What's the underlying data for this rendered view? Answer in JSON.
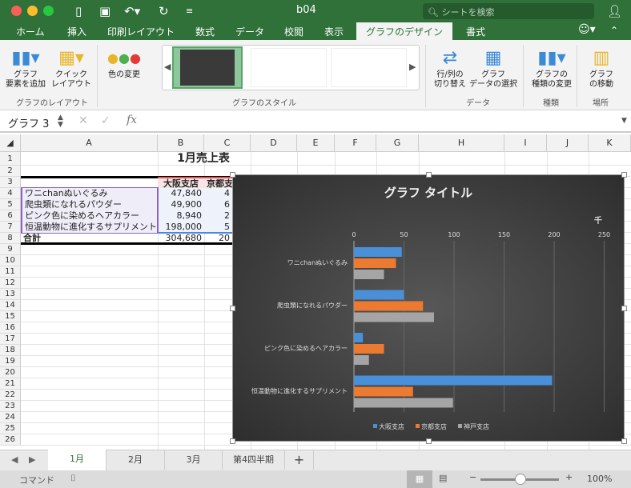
{
  "window": {
    "title": "b04",
    "search_placeholder": "シートを検索"
  },
  "tabs": [
    {
      "label": "ホーム"
    },
    {
      "label": "挿入"
    },
    {
      "label": "印刷レイアウト"
    },
    {
      "label": "数式"
    },
    {
      "label": "データ"
    },
    {
      "label": "校閲"
    },
    {
      "label": "表示"
    },
    {
      "label": "グラフのデザイン",
      "active": true
    },
    {
      "label": "書式"
    }
  ],
  "ribbon": {
    "add_element": "グラフ\n要素を追加",
    "quick_layout": "クイック\nレイアウト",
    "change_colors": "色の変更",
    "switch_row_col": "行/列の\n切り替え",
    "select_data": "グラフ\nデータの選択",
    "change_type": "グラフの\n種類の変更",
    "move_chart": "グラフ\nの移動",
    "groups": {
      "layout": "グラフのレイアウト",
      "styles": "グラフのスタイル",
      "data": "データ",
      "type": "種類",
      "location": "場所"
    }
  },
  "formula_bar": {
    "name_box": "グラフ 3",
    "fx": "fx",
    "value": ""
  },
  "columns": [
    "A",
    "B",
    "C",
    "D",
    "E",
    "F",
    "G",
    "H",
    "I",
    "J",
    "K"
  ],
  "rows": [
    "1",
    "2",
    "3",
    "4",
    "5",
    "6",
    "7",
    "8",
    "9",
    "10",
    "11",
    "12",
    "13",
    "14",
    "15",
    "16",
    "17",
    "18",
    "19",
    "20",
    "21",
    "22",
    "23",
    "24",
    "25",
    "26"
  ],
  "sheet": {
    "title": "1月売上表",
    "headers": [
      "大阪支店",
      "京都支店"
    ],
    "items": [
      {
        "name": "ワニchanぬいぐるみ",
        "osaka": "47,840",
        "kyoto": "4"
      },
      {
        "name": "爬虫類になれるパウダー",
        "osaka": "49,900",
        "kyoto": "6"
      },
      {
        "name": "ピンク色に染めるヘアカラー",
        "osaka": "8,940",
        "kyoto": "2"
      },
      {
        "name": "恒温動物に進化するサプリメント",
        "osaka": "198,000",
        "kyoto": "5"
      }
    ],
    "total": {
      "name": "合計",
      "osaka": "304,680",
      "kyoto": "20"
    }
  },
  "chart_data": {
    "type": "bar",
    "orientation": "horizontal",
    "title": "グラフ タイトル",
    "unit_label": "千",
    "categories": [
      "ワニchanぬいぐるみ",
      "爬虫類になれるパウダー",
      "ピンク色に染めるヘアカラー",
      "恒温動物に進化するサプリメント"
    ],
    "series": [
      {
        "name": "大阪支店",
        "values": [
          47.84,
          49.9,
          8.94,
          198
        ],
        "color": "#4a90d9"
      },
      {
        "name": "京都支店",
        "values": [
          42,
          69,
          30,
          59
        ],
        "color": "#ed7a31"
      },
      {
        "name": "神戸支店",
        "values": [
          30,
          80,
          15,
          99
        ],
        "color": "#a5a5a5"
      }
    ],
    "xlim": [
      0,
      250
    ],
    "xticks": [
      "0",
      "50",
      "100",
      "150",
      "200",
      "250"
    ],
    "grid": true,
    "legend": "bottom",
    "background": "#404040"
  },
  "sheet_tabs": [
    {
      "label": "1月",
      "active": true
    },
    {
      "label": "2月"
    },
    {
      "label": "3月"
    },
    {
      "label": "第4四半期"
    }
  ],
  "status": {
    "mode": "コマンド",
    "zoom": "100%",
    "zoom_level": 100
  }
}
